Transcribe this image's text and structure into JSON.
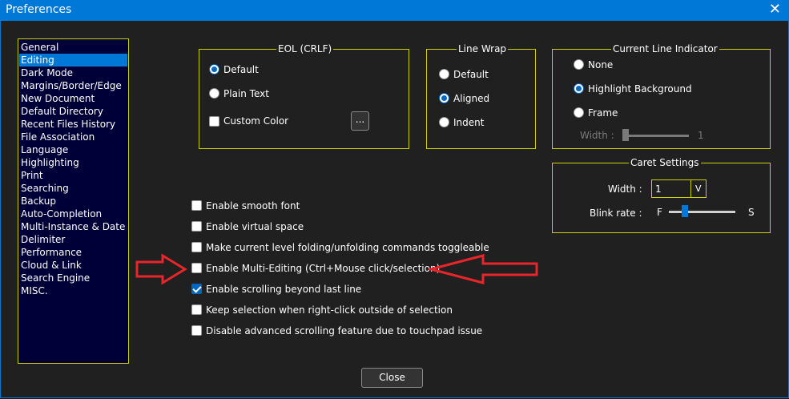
{
  "window": {
    "title": "Preferences",
    "close_glyph": "✕"
  },
  "categories": [
    "General",
    "Editing",
    "Dark Mode",
    "Margins/Border/Edge",
    "New Document",
    "Default Directory",
    "Recent Files History",
    "File Association",
    "Language",
    "Highlighting",
    "Print",
    "Searching",
    "Backup",
    "Auto-Completion",
    "Multi-Instance & Date",
    "Delimiter",
    "Performance",
    "Cloud & Link",
    "Search Engine",
    "MISC."
  ],
  "selected_category": "Editing",
  "eol": {
    "title": "EOL (CRLF)",
    "options": [
      {
        "label": "Default",
        "selected": true
      },
      {
        "label": "Plain Text",
        "selected": false
      }
    ],
    "custom_color": {
      "label": "Custom Color",
      "checked": false
    },
    "picker_label": "..."
  },
  "line_wrap": {
    "title": "Line Wrap",
    "options": [
      {
        "label": "Default",
        "selected": false
      },
      {
        "label": "Aligned",
        "selected": true
      },
      {
        "label": "Indent",
        "selected": false
      }
    ]
  },
  "current_line": {
    "title": "Current Line Indicator",
    "options": [
      {
        "label": "None",
        "selected": false
      },
      {
        "label": "Highlight Background",
        "selected": true
      },
      {
        "label": "Frame",
        "selected": false
      }
    ],
    "width_label": "Width :",
    "width_value": "1"
  },
  "caret": {
    "title": "Caret Settings",
    "width_label": "Width :",
    "width_value": "1",
    "dropdown_glyph": "V",
    "blink_label": "Blink rate :",
    "blink_min": "F",
    "blink_max": "S"
  },
  "options": [
    {
      "label": "Enable smooth font",
      "checked": false
    },
    {
      "label": "Enable virtual space",
      "checked": false
    },
    {
      "label": "Make current level folding/unfolding commands toggleable",
      "checked": false
    },
    {
      "label": "Enable Multi-Editing (Ctrl+Mouse click/selection)",
      "checked": false
    },
    {
      "label": "Enable scrolling beyond last line",
      "checked": true
    },
    {
      "label": "Keep selection when right-click outside of selection",
      "checked": false
    },
    {
      "label": "Disable advanced scrolling feature due to touchpad issue",
      "checked": false
    }
  ],
  "close_label": "Close",
  "colors": {
    "titlebar": "#0078d7",
    "background": "#202020",
    "group_border": "#cfcf00",
    "list_bg": "#000038",
    "selection": "#0078d7",
    "annotation_arrow": "#e8262a",
    "accent": "#0067c0"
  }
}
